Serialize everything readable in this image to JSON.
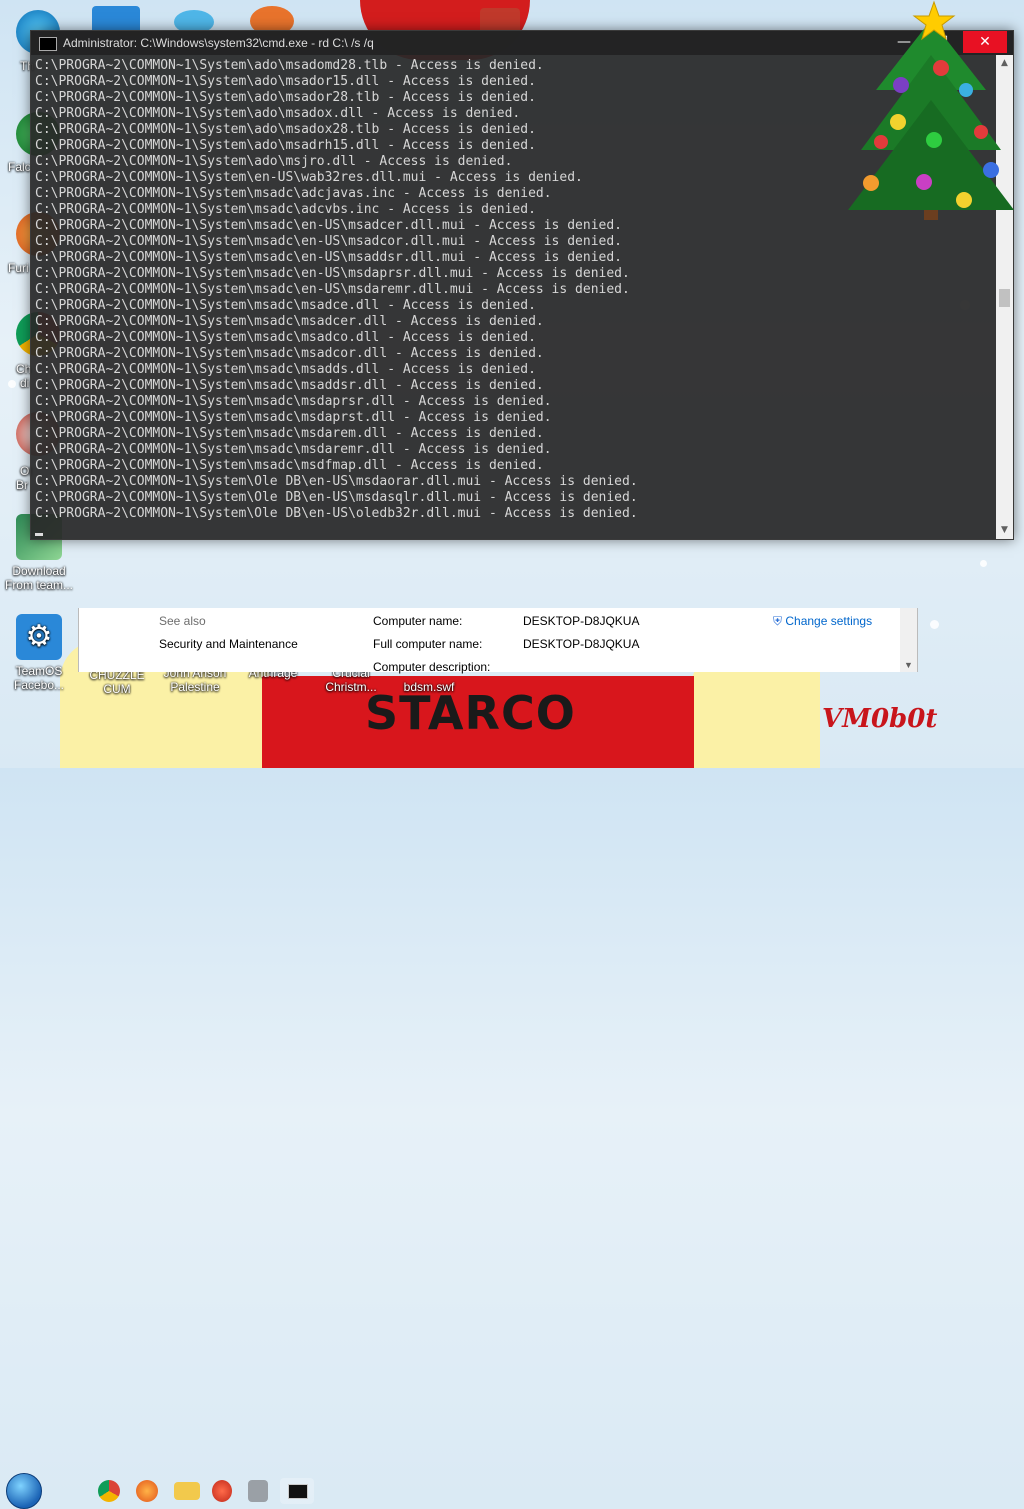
{
  "desktop": {
    "icons": [
      {
        "label": "Download From team...",
        "color": "#2e8b57"
      },
      {
        "label": "TeamOS Facebo...",
        "color": "#2a88d8"
      },
      {
        "label": "CHUZZLE CUM",
        "color": "#d93a2b"
      },
      {
        "label": "John Anson Palestine",
        "color": "#e8e8e8"
      },
      {
        "label": "Anthrage",
        "color": "#e8e8e8"
      },
      {
        "label": "Crucial Christm...",
        "color": "#e8e8e8"
      },
      {
        "label": "bdsm.swf",
        "color": "#e8e8e8"
      }
    ],
    "partial_labels": [
      "Th",
      "Falc",
      "Furi",
      "Ch",
      "di",
      "Ol",
      "Br"
    ],
    "wallpaper_text": "STARCO",
    "signature": "VM0b0t"
  },
  "system_window": {
    "see_also": "See also",
    "security_link": "Security and Maintenance",
    "rows": [
      {
        "label": "Computer name:",
        "value": "DESKTOP-D8JQKUA"
      },
      {
        "label": "Full computer name:",
        "value": "DESKTOP-D8JQKUA"
      },
      {
        "label": "Computer description:",
        "value": ""
      }
    ],
    "change_settings": "Change settings"
  },
  "cmd": {
    "title": "Administrator: C:\\Windows\\system32\\cmd.exe - rd  C:\\ /s /q",
    "minimize": "—",
    "maximize": "☐",
    "close": "✕",
    "lines": [
      "C:\\PROGRA~2\\COMMON~1\\System\\ado\\msadomd28.tlb - Access is denied.",
      "C:\\PROGRA~2\\COMMON~1\\System\\ado\\msador15.dll - Access is denied.",
      "C:\\PROGRA~2\\COMMON~1\\System\\ado\\msador28.tlb - Access is denied.",
      "C:\\PROGRA~2\\COMMON~1\\System\\ado\\msadox.dll - Access is denied.",
      "C:\\PROGRA~2\\COMMON~1\\System\\ado\\msadox28.tlb - Access is denied.",
      "C:\\PROGRA~2\\COMMON~1\\System\\ado\\msadrh15.dll - Access is denied.",
      "C:\\PROGRA~2\\COMMON~1\\System\\ado\\msjro.dll - Access is denied.",
      "C:\\PROGRA~2\\COMMON~1\\System\\en-US\\wab32res.dll.mui - Access is denied.",
      "C:\\PROGRA~2\\COMMON~1\\System\\msadc\\adcjavas.inc - Access is denied.",
      "C:\\PROGRA~2\\COMMON~1\\System\\msadc\\adcvbs.inc - Access is denied.",
      "C:\\PROGRA~2\\COMMON~1\\System\\msadc\\en-US\\msadcer.dll.mui - Access is denied.",
      "C:\\PROGRA~2\\COMMON~1\\System\\msadc\\en-US\\msadcor.dll.mui - Access is denied.",
      "C:\\PROGRA~2\\COMMON~1\\System\\msadc\\en-US\\msaddsr.dll.mui - Access is denied.",
      "C:\\PROGRA~2\\COMMON~1\\System\\msadc\\en-US\\msdaprsr.dll.mui - Access is denied.",
      "C:\\PROGRA~2\\COMMON~1\\System\\msadc\\en-US\\msdaremr.dll.mui - Access is denied.",
      "C:\\PROGRA~2\\COMMON~1\\System\\msadc\\msadce.dll - Access is denied.",
      "C:\\PROGRA~2\\COMMON~1\\System\\msadc\\msadcer.dll - Access is denied.",
      "C:\\PROGRA~2\\COMMON~1\\System\\msadc\\msadco.dll - Access is denied.",
      "C:\\PROGRA~2\\COMMON~1\\System\\msadc\\msadcor.dll - Access is denied.",
      "C:\\PROGRA~2\\COMMON~1\\System\\msadc\\msadds.dll - Access is denied.",
      "C:\\PROGRA~2\\COMMON~1\\System\\msadc\\msaddsr.dll - Access is denied.",
      "C:\\PROGRA~2\\COMMON~1\\System\\msadc\\msdaprsr.dll - Access is denied.",
      "C:\\PROGRA~2\\COMMON~1\\System\\msadc\\msdaprst.dll - Access is denied.",
      "C:\\PROGRA~2\\COMMON~1\\System\\msadc\\msdarem.dll - Access is denied.",
      "C:\\PROGRA~2\\COMMON~1\\System\\msadc\\msdaremr.dll - Access is denied.",
      "C:\\PROGRA~2\\COMMON~1\\System\\msadc\\msdfmap.dll - Access is denied.",
      "C:\\PROGRA~2\\COMMON~1\\System\\Ole DB\\en-US\\msdaorar.dll.mui - Access is denied.",
      "C:\\PROGRA~2\\COMMON~1\\System\\Ole DB\\en-US\\msdasqlr.dll.mui - Access is denied.",
      "C:\\PROGRA~2\\COMMON~1\\System\\Ole DB\\en-US\\oledb32r.dll.mui - Access is denied."
    ]
  },
  "taskbar": {
    "items": [
      {
        "icon": "windows-start-icon",
        "color": "#1b63b5"
      },
      {
        "icon": "chrome-icon",
        "color": "#e0433a"
      },
      {
        "icon": "firefox-icon",
        "color": "#f07c1a"
      },
      {
        "icon": "file-explorer-icon",
        "color": "#f2c94c"
      },
      {
        "icon": "app-icon",
        "color": "#d93a2b"
      },
      {
        "icon": "program-icon",
        "color": "#9aa0a6"
      },
      {
        "icon": "command-prompt-icon",
        "color": "#111111"
      }
    ]
  }
}
